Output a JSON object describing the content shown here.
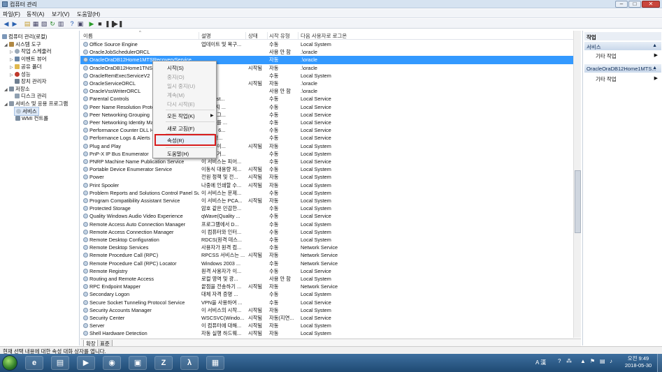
{
  "window": {
    "title": "컴퓨터 관리"
  },
  "menu": [
    "파일(F)",
    "동작(A)",
    "보기(V)",
    "도움말(H)"
  ],
  "tree": [
    {
      "label": "컴퓨터 관리(로컬)",
      "icon": "computer-icon"
    },
    {
      "label": "시스템 도구",
      "icon": "tools-icon"
    },
    {
      "label": "작업 스케줄러",
      "icon": "clock-icon"
    },
    {
      "label": "이벤트 뷰어",
      "icon": "event-viewer-icon"
    },
    {
      "label": "공유 폴더",
      "icon": "folder-icon"
    },
    {
      "label": "성능",
      "icon": "performance-icon"
    },
    {
      "label": "장치 관리자",
      "icon": "device-manager-icon"
    },
    {
      "label": "저장소",
      "icon": "storage-icon"
    },
    {
      "label": "디스크 관리",
      "icon": "disk-icon"
    },
    {
      "label": "서비스 및 응용 프로그램",
      "icon": "services-apps-icon"
    },
    {
      "label": "서비스",
      "icon": "services-icon"
    },
    {
      "label": "WMI 컨트롤",
      "icon": "wmi-icon"
    }
  ],
  "columns": {
    "name": "이름",
    "desc": "설명",
    "status": "상태",
    "startup": "시작 유형",
    "logon": "다음 사용자로 로그온"
  },
  "services": [
    {
      "name": "Office Source Engine",
      "desc": "업데이트 및 복구...",
      "status": "",
      "startup": "수동",
      "logon": "Local System"
    },
    {
      "name": "OracleJobSchedulerORCL",
      "desc": "",
      "status": "",
      "startup": "사용 안 함",
      "logon": ".\\oracle"
    },
    {
      "name": "OracleOraDB12Home1MTSRecoveryService",
      "desc": "",
      "status": "",
      "startup": "자동",
      "logon": ".\\oracle"
    },
    {
      "name": "OracleOraDB12Home1TNSListener",
      "desc": "",
      "status": "시작됨",
      "startup": "자동",
      "logon": ".\\oracle"
    },
    {
      "name": "OracleRemExecServiceV2",
      "desc": "",
      "status": "",
      "startup": "수동",
      "logon": "Local System"
    },
    {
      "name": "OracleServiceORCL",
      "desc": "",
      "status": "시작됨",
      "startup": "자동",
      "logon": ".\\oracle"
    },
    {
      "name": "OracleVssWriterORCL",
      "desc": "",
      "status": "",
      "startup": "사용 안 함",
      "logon": ".\\oracle"
    },
    {
      "name": "Parental Controls",
      "desc": "스는 Vist...",
      "status": "",
      "startup": "수동",
      "logon": "Local Service"
    },
    {
      "name": "Peer Name Resolution Protocol",
      "desc": "사용하지 ...",
      "status": "",
      "startup": "수동",
      "logon": "Local Service"
    },
    {
      "name": "Peer Networking Grouping",
      "desc": "트워킹 그...",
      "status": "",
      "startup": "수동",
      "logon": "Local Service"
    },
    {
      "name": "Peer Networking Identity Manager",
      "desc": "되어 이를 ...",
      "status": "",
      "startup": "수동",
      "logon": "Local Service"
    },
    {
      "name": "Performance Counter DLL Host",
      "desc": "용자 및 6...",
      "status": "",
      "startup": "수동",
      "logon": "Local Service"
    },
    {
      "name": "Performance Logs & Alerts",
      "desc": "그 및 경...",
      "status": "",
      "startup": "수동",
      "logon": "Local Service"
    },
    {
      "name": "Plug and Play",
      "desc": "입력 없이...",
      "status": "시작됨",
      "startup": "자동",
      "logon": "Local System"
    },
    {
      "name": "PnP-X IP Bus Enumerator",
      "desc": "버스 열거...",
      "status": "",
      "startup": "수동",
      "logon": "Local System"
    },
    {
      "name": "PNRP Machine Name Publication Service",
      "desc": "이 서비스는 피어...",
      "status": "",
      "startup": "수동",
      "logon": "Local Service"
    },
    {
      "name": "Portable Device Enumerator Service",
      "desc": "이동식 대용량 저...",
      "status": "시작됨",
      "startup": "수동",
      "logon": "Local System"
    },
    {
      "name": "Power",
      "desc": "전원 정책 및 전...",
      "status": "시작됨",
      "startup": "자동",
      "logon": "Local System"
    },
    {
      "name": "Print Spooler",
      "desc": "나중에 인쇄할 수...",
      "status": "시작됨",
      "startup": "자동",
      "logon": "Local System"
    },
    {
      "name": "Problem Reports and Solutions Control Panel Support",
      "desc": "이 서비스는 문제...",
      "status": "",
      "startup": "수동",
      "logon": "Local System"
    },
    {
      "name": "Program Compatibility Assistant Service",
      "desc": "이 서비스는 PCA...",
      "status": "시작됨",
      "startup": "자동",
      "logon": "Local System"
    },
    {
      "name": "Protected Storage",
      "desc": "암호 같은 민감한...",
      "status": "",
      "startup": "수동",
      "logon": "Local System"
    },
    {
      "name": "Quality Windows Audio Video Experience",
      "desc": "qWave(Quality ...",
      "status": "",
      "startup": "수동",
      "logon": "Local Service"
    },
    {
      "name": "Remote Access Auto Connection Manager",
      "desc": "프로그램에서 D...",
      "status": "",
      "startup": "수동",
      "logon": "Local System"
    },
    {
      "name": "Remote Access Connection Manager",
      "desc": "이 컴퓨터와 인터...",
      "status": "",
      "startup": "수동",
      "logon": "Local System"
    },
    {
      "name": "Remote Desktop Configuration",
      "desc": "RDCS(원격 데스...",
      "status": "",
      "startup": "수동",
      "logon": "Local System"
    },
    {
      "name": "Remote Desktop Services",
      "desc": "사용자가 원격 컴...",
      "status": "",
      "startup": "수동",
      "logon": "Network Service"
    },
    {
      "name": "Remote Procedure Call (RPC)",
      "desc": "RPCSS 서비스는 ...",
      "status": "시작됨",
      "startup": "자동",
      "logon": "Network Service"
    },
    {
      "name": "Remote Procedure Call (RPC) Locator",
      "desc": "Windows 2003 ...",
      "status": "",
      "startup": "수동",
      "logon": "Network Service"
    },
    {
      "name": "Remote Registry",
      "desc": "원격 사용자가 이...",
      "status": "",
      "startup": "수동",
      "logon": "Local Service"
    },
    {
      "name": "Routing and Remote Access",
      "desc": "로컬 영역 및 광...",
      "status": "",
      "startup": "사용 안 함",
      "logon": "Local System"
    },
    {
      "name": "RPC Endpoint Mapper",
      "desc": "끝점을 전송하기 ...",
      "status": "시작됨",
      "startup": "자동",
      "logon": "Network Service"
    },
    {
      "name": "Secondary Logon",
      "desc": "대체 자격 증명 ...",
      "status": "",
      "startup": "수동",
      "logon": "Local System"
    },
    {
      "name": "Secure Socket Tunneling Protocol Service",
      "desc": "VPN을 사용하여 ...",
      "status": "",
      "startup": "수동",
      "logon": "Local Service"
    },
    {
      "name": "Security Accounts Manager",
      "desc": "이 서비스의 시작...",
      "status": "시작됨",
      "startup": "자동",
      "logon": "Local System"
    },
    {
      "name": "Security Center",
      "desc": "WSCSVC(Windo...",
      "status": "시작됨",
      "startup": "자동(지연...",
      "logon": "Local Service"
    },
    {
      "name": "Server",
      "desc": "이 컴퓨터에 대해...",
      "status": "시작됨",
      "startup": "자동",
      "logon": "Local System"
    },
    {
      "name": "Shell Hardware Detection",
      "desc": "자동 실행 하드웨...",
      "status": "시작됨",
      "startup": "자동",
      "logon": "Local System"
    }
  ],
  "selected_index": 2,
  "context_menu": [
    {
      "label": "시작(S)",
      "disabled": false
    },
    {
      "label": "중지(O)",
      "disabled": true
    },
    {
      "label": "일시 중지(U)",
      "disabled": true
    },
    {
      "label": "계속(M)",
      "disabled": true
    },
    {
      "label": "다시 시작(E)",
      "disabled": true
    },
    {
      "label": "모든 작업(K)",
      "disabled": false,
      "submenu": true
    },
    {
      "label": "새로 고침(F)",
      "disabled": false
    },
    {
      "label": "속성(R)",
      "disabled": false,
      "highlighted": true
    },
    {
      "label": "도움말(H)",
      "disabled": false
    }
  ],
  "tabs": [
    "확장",
    "표준"
  ],
  "actions": {
    "header": "작업",
    "sections": [
      {
        "title": "서비스",
        "items": [
          "기타 작업"
        ]
      },
      {
        "title": "OracleOraDB12Home1MTS...",
        "items": [
          "기타 작업"
        ]
      }
    ]
  },
  "statusbar": "현재 선택 내용에 대한 속성 대화 상자를 엽니다.",
  "taskbar": {
    "apps": [
      {
        "name": "internet-explorer-icon",
        "glyph": "e"
      },
      {
        "name": "file-explorer-icon",
        "glyph": "▤"
      },
      {
        "name": "media-player-icon",
        "glyph": "▶"
      },
      {
        "name": "chrome-icon",
        "glyph": "◉"
      },
      {
        "name": "app-icon",
        "glyph": "▣"
      },
      {
        "name": "filezilla-icon",
        "glyph": "Z"
      },
      {
        "name": "acrobat-icon",
        "glyph": "λ"
      },
      {
        "name": "computer-management-icon",
        "glyph": "▦"
      }
    ],
    "tray_text": "A 漢",
    "time": "오전 9:49",
    "date": "2018-05-30"
  },
  "colors": {
    "selection": "#3399ff",
    "highlight_border": "#d81c1c"
  }
}
